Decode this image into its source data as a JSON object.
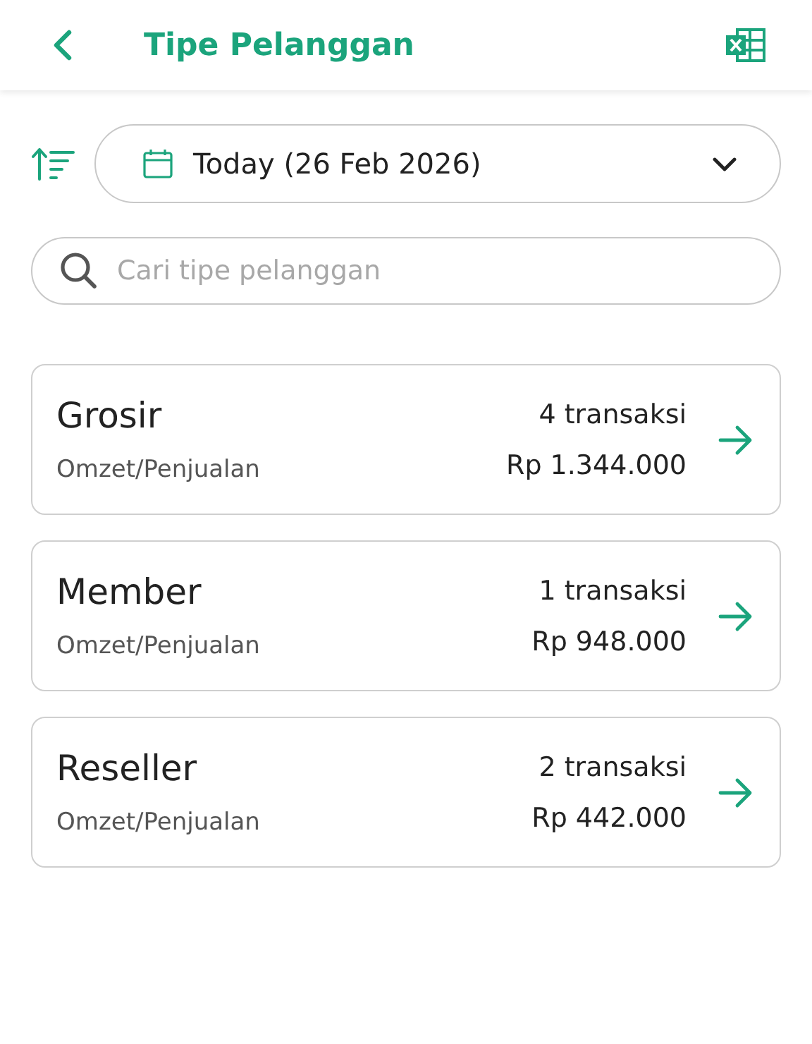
{
  "header": {
    "title": "Tipe Pelanggan"
  },
  "date_filter": {
    "value": "Today (26 Feb 2026)"
  },
  "search": {
    "placeholder": "Cari tipe pelanggan"
  },
  "customer_types": [
    {
      "name": "Grosir",
      "transactions": "4 transaksi",
      "label": "Omzet/Penjualan",
      "amount": "Rp 1.344.000"
    },
    {
      "name": "Member",
      "transactions": "1 transaksi",
      "label": "Omzet/Penjualan",
      "amount": "Rp 948.000"
    },
    {
      "name": "Reseller",
      "transactions": "2 transaksi",
      "label": "Omzet/Penjualan",
      "amount": "Rp 442.000"
    }
  ]
}
